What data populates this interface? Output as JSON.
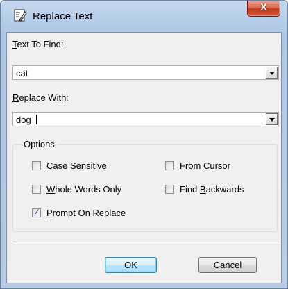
{
  "window": {
    "title": "Replace Text",
    "close_glyph": "X"
  },
  "find": {
    "label_accel": "T",
    "label_rest": "ext To Find:",
    "value": "cat"
  },
  "replace": {
    "label_accel": "R",
    "label_rest": "eplace With:",
    "value": "dog"
  },
  "options": {
    "legend": "Options",
    "items": [
      {
        "accel": "C",
        "rest": "ase Sensitive",
        "checked": false
      },
      {
        "accel": "F",
        "rest": "rom Cursor",
        "checked": false
      },
      {
        "accel": "W",
        "rest": "hole Words Only",
        "checked": false
      },
      {
        "pre": "Find ",
        "accel": "B",
        "rest": "ackwards",
        "checked": false
      },
      {
        "accel": "P",
        "rest": "rompt On Replace",
        "checked": true
      }
    ]
  },
  "buttons": {
    "ok": "OK",
    "cancel": "Cancel"
  },
  "icons": {
    "title": "replace-text-icon",
    "close": "close-icon",
    "dropdown": "chevron-down-icon"
  }
}
